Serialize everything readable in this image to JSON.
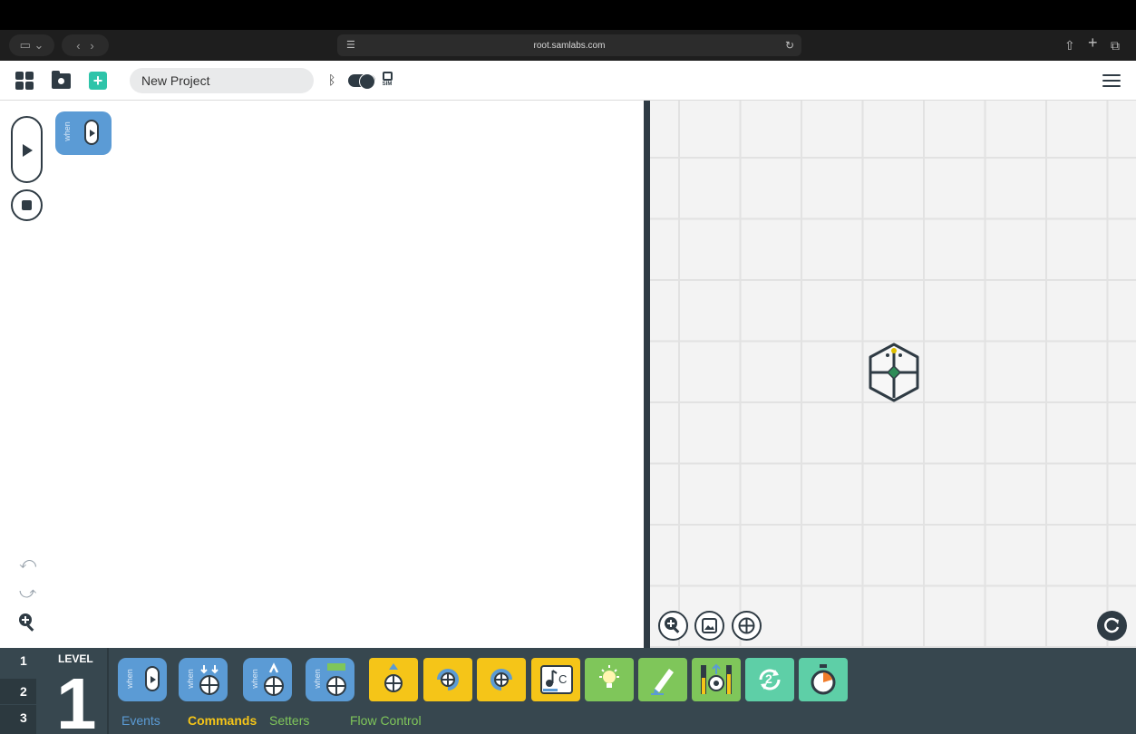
{
  "browser": {
    "url": "root.samlabs.com"
  },
  "toolbar": {
    "project_name": "New Project",
    "sim_label": "SIM"
  },
  "workspace": {
    "block_label": "when"
  },
  "palette": {
    "level_label": "LEVEL",
    "current_level": "1",
    "levels": [
      "1",
      "2",
      "3"
    ],
    "categories": {
      "events": "Events",
      "commands": "Commands",
      "setters": "Setters",
      "flow": "Flow Control"
    },
    "when_label": "when",
    "note_label": "C",
    "repeat_count": "2"
  },
  "colors": {
    "events": "#5b9bd5",
    "commands": "#f5c518",
    "setters": "#7fc65a",
    "flow": "#5ecfa7",
    "dark": "#2f3b44"
  }
}
